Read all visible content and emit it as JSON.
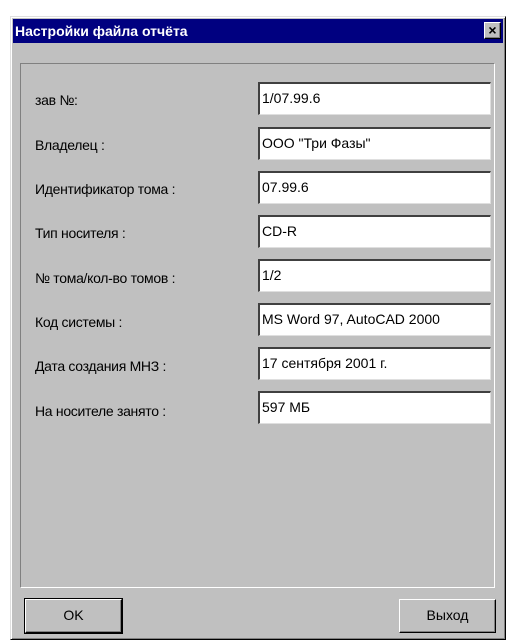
{
  "dialog": {
    "title": "Настройки файла отчёта",
    "close_label": "×"
  },
  "fields": [
    {
      "label": "зав №:",
      "value": "1/07.99.6"
    },
    {
      "label": "Владелец :",
      "value": "ООО \"Три Фазы\""
    },
    {
      "label": "Идентификатор тома :",
      "value": "07.99.6"
    },
    {
      "label": "Тип носителя :",
      "value": "CD-R"
    },
    {
      "label": "№ тома/кол-во томов :",
      "value": "1/2"
    },
    {
      "label": "Код системы :",
      "value": "MS Word 97, AutoCAD 2000"
    },
    {
      "label": "Дата создания МНЗ :",
      "value": "17 сентября 2001 г."
    },
    {
      "label": "На носителе занято :",
      "value": "597 МБ"
    }
  ],
  "buttons": {
    "ok_label": "OK",
    "exit_label": "Выход"
  }
}
